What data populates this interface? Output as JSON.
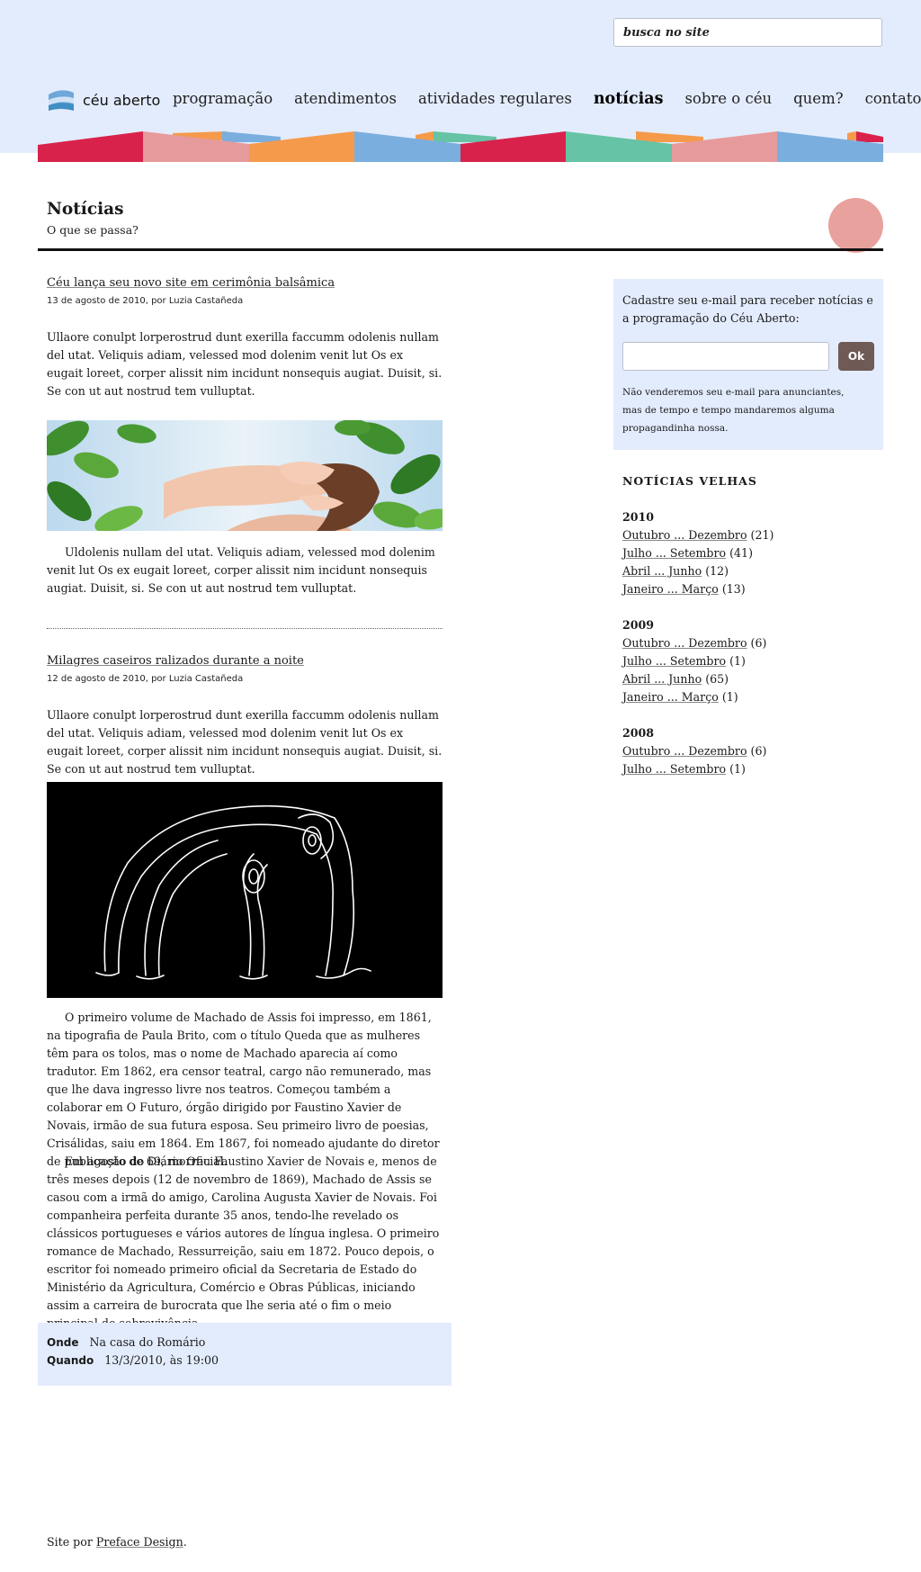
{
  "header": {
    "search_placeholder": "busca no site",
    "logo_text": "céu aberto",
    "nav": [
      {
        "label": "programação",
        "active": false
      },
      {
        "label": "atendimentos",
        "active": false
      },
      {
        "label": "atividades regulares",
        "active": false
      },
      {
        "label": "notícias",
        "active": true
      },
      {
        "label": "sobre o céu",
        "active": false
      },
      {
        "label": "quem?",
        "active": false
      },
      {
        "label": "contato",
        "active": false
      }
    ],
    "stripe_colors": [
      "#d9224b",
      "#e79a9b",
      "#f59a4b",
      "#7aaede",
      "#d9224b",
      "#66c3a5",
      "#e79a9b",
      "#7aaede"
    ]
  },
  "page": {
    "title": "Notícias",
    "subtitle": "O que se passa?",
    "accent_circle_color": "#e8a19c"
  },
  "articles": [
    {
      "title": "Céu lança seu novo site em cerimônia balsâmica",
      "meta": "13 de agosto de 2010, por Luzia Castañeda",
      "intro": "Ullaore conulpt lorperostrud dunt exerilla faccumm odolenis nullam del utat. Veliquis adiam, velessed mod dolenim venit lut Os ex eugait loreet, corper alissit nim incidunt nonsequis augiat. Duisit, si. Se con ut aut nostrud tem vulluptat.",
      "image": "massage-photo",
      "body": "Uldolenis nullam del utat. Veliquis adiam, velessed mod dolenim venit lut Os ex eugait loreet, corper alissit nim incidunt nonsequis augiat. Duisit, si. Se con ut aut nostrud tem vulluptat."
    },
    {
      "title": "Milagres caseiros ralizados durante a noite",
      "meta": "12 de agosto de 2010, por Luzia Castañeda",
      "intro": "Ullaore conulpt lorperostrud dunt exerilla faccumm odolenis nullam del utat. Veliquis adiam, velessed mod dolenim venit lut Os ex eugait loreet, corper alissit nim incidunt nonsequis augiat. Duisit, si. Se con ut aut nostrud tem vulluptat.",
      "image": "line-drawing-figure",
      "body1": "O primeiro volume de Machado de Assis foi impresso, em 1861, na tipografia de Paula Brito, com o título Queda que as mulheres têm para os tolos, mas o nome de Machado aparecia aí como tradutor. Em 1862, era censor teatral, cargo não remunerado, mas que lhe dava ingresso livre nos teatros. Começou também a colaborar em O Futuro, órgão dirigido por Faustino Xavier de Novais, irmão de sua futura esposa. Seu primeiro livro de poesias, Crisálidas, saiu em 1864. Em 1867, foi nomeado ajudante do diretor de publicação do Diário Oficial.",
      "body2": "Em agosto de 69, morreu Faustino Xavier de Novais e, menos de três meses depois (12 de novembro de 1869), Machado de Assis se casou com a irmã do amigo, Carolina Augusta Xavier de Novais. Foi companheira perfeita durante 35 anos, tendo-lhe revelado os clássicos portugueses e vários autores de língua inglesa. O primeiro romance de Machado, Ressurreição, saiu em 1872. Pouco depois, o escritor foi nomeado primeiro oficial da Secretaria de Estado do Ministério da Agricultura, Comércio e Obras Públicas, iniciando assim a carreira de burocrata que lhe seria até o fim o meio principal de sobrevivência.",
      "where_label": "Onde",
      "where_value": "Na casa do Romário",
      "when_label": "Quando",
      "when_value": "13/3/2010, às 19:00"
    }
  ],
  "sidebar": {
    "newsletter_text": "Cadastre seu e-mail para receber notícias e a programação do Céu Aberto:",
    "newsletter_button": "Ok",
    "newsletter_note": "Não venderemos seu e-mail para anunciantes, mas de tempo e tempo mandaremos alguma propagandinha nossa.",
    "archive_title": "NOTÍCIAS VELHAS",
    "years": [
      {
        "year": "2010",
        "periods": [
          {
            "label": "Outubro ... Dezembro",
            "count": "(21)"
          },
          {
            "label": "Julho ... Setembro",
            "count": "(41)"
          },
          {
            "label": "Abril ... Junho",
            "count": "(12)"
          },
          {
            "label": "Janeiro ... Março",
            "count": "(13)"
          }
        ]
      },
      {
        "year": "2009",
        "periods": [
          {
            "label": "Outubro ... Dezembro",
            "count": "(6)"
          },
          {
            "label": "Julho ... Setembro",
            "count": "(1)"
          },
          {
            "label": "Abril ... Junho",
            "count": "(65)"
          },
          {
            "label": "Janeiro ... Março",
            "count": "(1)"
          }
        ]
      },
      {
        "year": "2008",
        "periods": [
          {
            "label": "Outubro ... Dezembro",
            "count": "(6)"
          },
          {
            "label": "Julho ... Setembro",
            "count": "(1)"
          }
        ]
      }
    ]
  },
  "footer": {
    "prefix": "Site por",
    "link": "Preface Design",
    "suffix": "."
  }
}
